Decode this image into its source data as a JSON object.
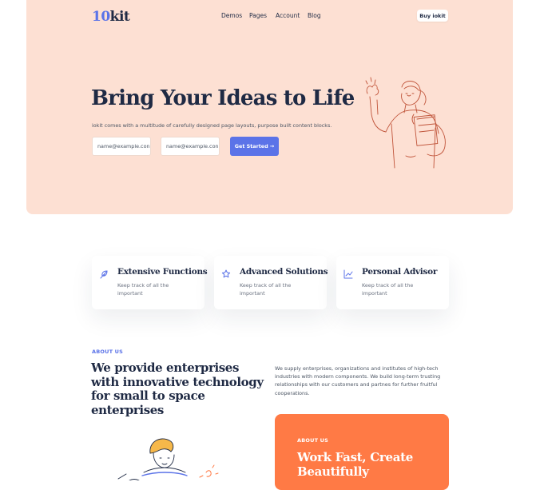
{
  "brand": {
    "logo_num": "10",
    "logo_text": "kit"
  },
  "nav": {
    "items": [
      "Demos",
      "Pages",
      "Account",
      "Blog"
    ],
    "cta": "Buy iokit"
  },
  "hero": {
    "title": "Bring Your Ideas to Life",
    "subtitle": "iokit comes with a multitude of carefully designed page layouts, purpose built content blocks.",
    "email_1_placeholder": "name@example.con",
    "email_2_placeholder": "name@example.con",
    "cta": "Get Started →"
  },
  "features": [
    {
      "icon": "feather-icon",
      "title": "Extensive Functions",
      "desc": "Keep track of all the important"
    },
    {
      "icon": "star-icon",
      "title": "Advanced Solutions",
      "desc": "Keep track of all the important"
    },
    {
      "icon": "chart-line-icon",
      "title": "Personal Advisor",
      "desc": "Keep track of all the important"
    }
  ],
  "about": {
    "label": "ABOUT US",
    "title": "We provide enterprises with innovative technology for small to space enterprises",
    "text": "We supply enterprises, organizations and institutes of high-tech industries with modern components. We build long-term trusting relationships with our customers and partnes for further fruitful cooperations."
  },
  "promo": {
    "label": "ABOUT US",
    "title": "Work Fast, Create Beautifully"
  },
  "colors": {
    "accent": "#5b73e8",
    "hero_bg": "#fde0d3",
    "promo_bg": "#ff7a45",
    "text": "#1f2a44"
  }
}
